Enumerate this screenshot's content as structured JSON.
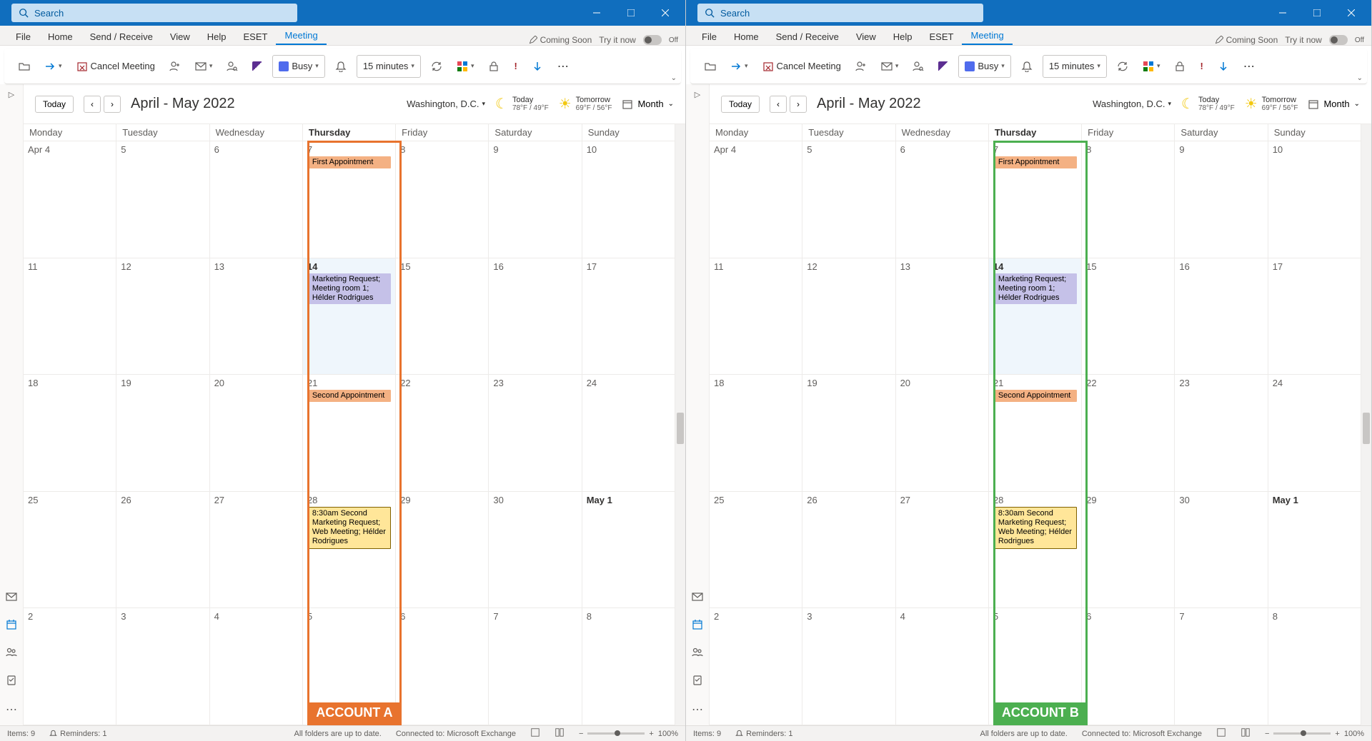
{
  "search_placeholder": "Search",
  "tabs": [
    "File",
    "Home",
    "Send / Receive",
    "View",
    "Help",
    "ESET",
    "Meeting"
  ],
  "active_tab": "Meeting",
  "coming_soon": "Coming Soon",
  "try_it_now": "Try it now",
  "toggle_label": "Off",
  "toolbar": {
    "cancel_meeting": "Cancel Meeting",
    "busy": "Busy",
    "reminder": "15 minutes"
  },
  "calendar": {
    "today_btn": "Today",
    "period": "April - May 2022",
    "location": "Washington, D.C.",
    "weather": {
      "today_label": "Today",
      "today_temp": "78°F / 49°F",
      "tomorrow_label": "Tomorrow",
      "tomorrow_temp": "69°F / 56°F"
    },
    "view_label": "Month",
    "day_headers": [
      "Monday",
      "Tuesday",
      "Wednesday",
      "Thursday",
      "Friday",
      "Saturday",
      "Sunday"
    ],
    "weeks": [
      [
        {
          "n": "Apr 4"
        },
        {
          "n": "5"
        },
        {
          "n": "6"
        },
        {
          "n": "7",
          "appts": [
            {
              "cls": "orange",
              "t": "First Appointment"
            }
          ]
        },
        {
          "n": "8"
        },
        {
          "n": "9"
        },
        {
          "n": "10"
        }
      ],
      [
        {
          "n": "11"
        },
        {
          "n": "12"
        },
        {
          "n": "13"
        },
        {
          "n": "14",
          "today": true,
          "appts": [
            {
              "cls": "purple",
              "t": "Marketing Request; Meeting room 1; Hélder Rodrigues"
            }
          ]
        },
        {
          "n": "15"
        },
        {
          "n": "16"
        },
        {
          "n": "17"
        }
      ],
      [
        {
          "n": "18"
        },
        {
          "n": "19"
        },
        {
          "n": "20"
        },
        {
          "n": "21",
          "appts": [
            {
              "cls": "orange",
              "t": "Second Appointment"
            }
          ]
        },
        {
          "n": "22"
        },
        {
          "n": "23"
        },
        {
          "n": "24"
        }
      ],
      [
        {
          "n": "25"
        },
        {
          "n": "26"
        },
        {
          "n": "27"
        },
        {
          "n": "28",
          "appts": [
            {
              "cls": "yellow",
              "t": "8:30am Second Marketing Request; Web Meeting; Hélder Rodrigues"
            }
          ]
        },
        {
          "n": "29"
        },
        {
          "n": "30"
        },
        {
          "n": "May 1",
          "bold": true
        }
      ],
      [
        {
          "n": "2"
        },
        {
          "n": "3"
        },
        {
          "n": "4"
        },
        {
          "n": "5"
        },
        {
          "n": "6"
        },
        {
          "n": "7"
        },
        {
          "n": "8"
        }
      ]
    ]
  },
  "highlights": {
    "a": {
      "color": "#e8732e",
      "label": "ACCOUNT A"
    },
    "b": {
      "color": "#4caf50",
      "label": "ACCOUNT B"
    }
  },
  "status": {
    "items": "Items: 9",
    "reminders": "Reminders: 1",
    "folders": "All folders are up to date.",
    "connected": "Connected to: Microsoft Exchange",
    "zoom": "100%"
  }
}
